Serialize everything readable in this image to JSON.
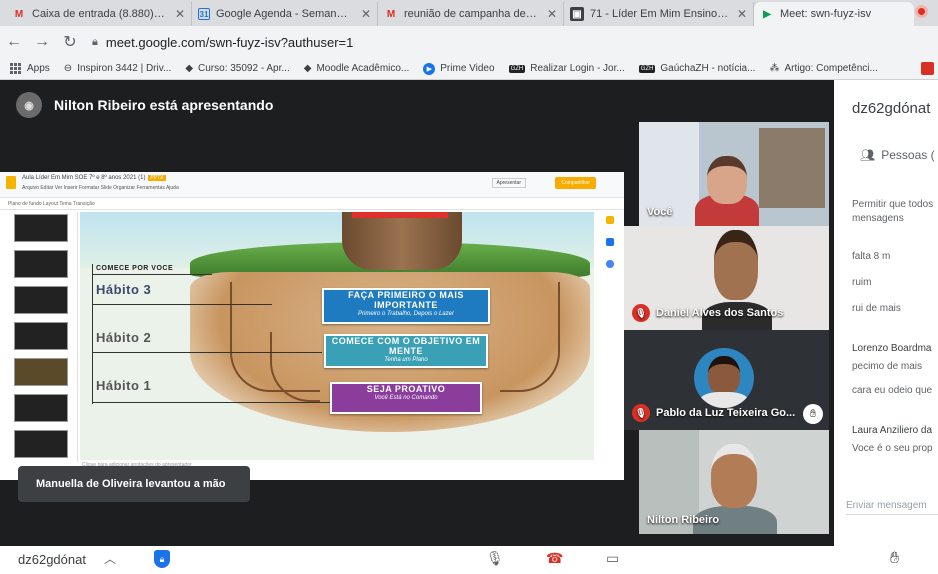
{
  "browser": {
    "tabs": [
      {
        "icon": "gmail-icon",
        "glyph": "M",
        "title": "Caixa de entrada (8.880) - mlbs",
        "active": false
      },
      {
        "icon": "calendar-icon",
        "glyph": "31",
        "title": "Google Agenda - Semana de 1",
        "active": false
      },
      {
        "icon": "gmail-icon",
        "glyph": "M",
        "title": "reunião de campanha de Matr",
        "active": false
      },
      {
        "icon": "classroom-icon",
        "glyph": "▣",
        "title": "71 - Líder Em Mim Ensino Func",
        "active": false
      },
      {
        "icon": "meet-icon",
        "glyph": "▶",
        "title": "Meet: swn-fuyz-isv",
        "active": true
      }
    ],
    "url": "meet.google.com/swn-fuyz-isv?authuser=1",
    "bookmarks": [
      {
        "icon": "apps-icon",
        "label": "Apps"
      },
      {
        "icon": "globe-icon",
        "glyph": "⊖",
        "label": "Inspiron 3442 | Driv..."
      },
      {
        "icon": "diamond-icon",
        "glyph": "◆",
        "label": "Curso: 35092 - Apr..."
      },
      {
        "icon": "diamond-icon",
        "glyph": "◆",
        "label": "Moodle Acadêmico..."
      },
      {
        "icon": "prime-video-icon",
        "glyph": "▶",
        "label": "Prime Video"
      },
      {
        "icon": "gzh-icon",
        "glyph": "GZH",
        "label": "Realizar Login - Jor..."
      },
      {
        "icon": "gzh-icon",
        "glyph": "GZH",
        "label": "GaúchaZH - notícia..."
      },
      {
        "icon": "chart-icon",
        "glyph": "⁂",
        "label": "Artigo: Competênci..."
      }
    ]
  },
  "meeting": {
    "presenter_text": "Nilton Ribeiro está apresentando",
    "hand_raised_toast": "Manuella de Oliveira levantou a mão",
    "meeting_code": "dz62gdónat",
    "people_label": "Pessoas (",
    "participants": [
      {
        "name": "Você",
        "muted": false,
        "hand": false
      },
      {
        "name": "Daniel Alves dos Santos",
        "muted": true,
        "hand": false
      },
      {
        "name": "Pablo da Luz Teixeira Go...",
        "muted": true,
        "hand": true
      },
      {
        "name": "Nilton Ribeiro",
        "muted": false,
        "hand": false
      }
    ]
  },
  "shared_screen": {
    "doc_title": "Aula Líder Em Mim SOE 7º e 8º anos 2021 (1)",
    "doc_badge": "PPTX",
    "menu": "Arquivo  Editar  Ver  Inserir  Formatar  Slide  Organizar  Ferramentas  Ajuda",
    "toolbar": "Plano de fundo   Layout   Tema   Transição",
    "present_label": "Apresentar",
    "share_label": "Compartilhar",
    "notes_placeholder": "Clique para adicionar anotações do apresentador",
    "slide": {
      "header": "COMECE POR VOCE",
      "habits": [
        "Hábito 3",
        "Hábito 2",
        "Hábito 1"
      ],
      "signs": [
        {
          "title": "FAÇA PRIMEIRO O MAIS IMPORTANTE",
          "subtitle": "Primeiro o Trabalho, Depois o Lazer"
        },
        {
          "title": "COMECE COM O OBJETIVO EM MENTE",
          "subtitle": "Tenha um Plano"
        },
        {
          "title": "SEJA PROATIVO",
          "subtitle": "Você Está no Comando"
        }
      ]
    }
  },
  "chat": {
    "messages": [
      "Permitir que todos",
      "mensagens",
      "falta 8 m",
      "ruim",
      "rui de mais",
      "Lorenzo Boardma",
      "pecimo de mais",
      "cara eu odeio que",
      "Laura Anziliero da",
      "Voce é o seu prop"
    ],
    "input_placeholder": "Enviar mensagem"
  },
  "colors": {
    "stage_bg": "#1d1e20",
    "muted_red": "#d93025",
    "sign_blue": "#1f7bbf",
    "sign_teal": "#3aa0b5",
    "sign_purple": "#8a3d9b"
  }
}
